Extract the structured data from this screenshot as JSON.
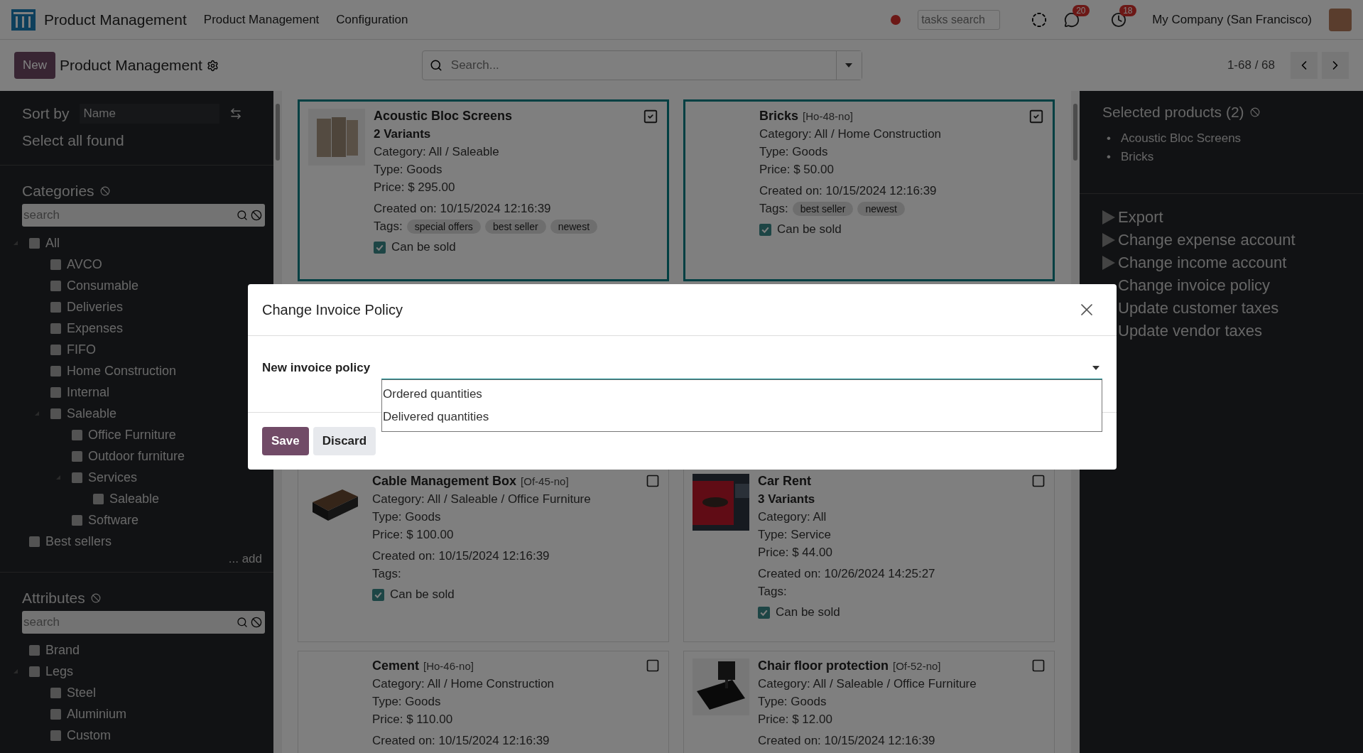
{
  "navbar": {
    "app_name": "Product Management",
    "menus": [
      "Product Management",
      "Configuration"
    ],
    "tasks_search": {
      "placeholder": "tasks search"
    },
    "messages_badge": "20",
    "activities_badge": "18",
    "company": "My Company (San Francisco)"
  },
  "control_panel": {
    "new_button": "New",
    "breadcrumb": "Product Management",
    "search": {
      "placeholder": "Search..."
    },
    "pager": "1-68 / 68"
  },
  "sidebar": {
    "sort_label": "Sort by",
    "sort_value": "Name",
    "select_all": "Select all found",
    "sections": [
      {
        "title": "Categories",
        "search_placeholder": "search",
        "add_link": "... add",
        "tree": [
          {
            "label": "All",
            "checked": false,
            "children": [
              {
                "label": "AVCO",
                "checked": false
              },
              {
                "label": "Consumable",
                "checked": false
              },
              {
                "label": "Deliveries",
                "checked": false
              },
              {
                "label": "Expenses",
                "checked": false
              },
              {
                "label": "FIFO",
                "checked": false
              },
              {
                "label": "Home Construction",
                "checked": false
              },
              {
                "label": "Internal",
                "checked": false
              },
              {
                "label": "Saleable",
                "checked": false,
                "children": [
                  {
                    "label": "Office Furniture",
                    "checked": false
                  },
                  {
                    "label": "Outdoor furniture",
                    "checked": false
                  },
                  {
                    "label": "Services",
                    "checked": false,
                    "children": [
                      {
                        "label": "Saleable",
                        "checked": false
                      }
                    ]
                  },
                  {
                    "label": "Software",
                    "checked": false
                  }
                ]
              }
            ]
          },
          {
            "label": "Best sellers",
            "checked": false
          }
        ]
      },
      {
        "title": "Attributes",
        "search_placeholder": "search",
        "tree": [
          {
            "label": "Brand",
            "checked": false
          },
          {
            "label": "Legs",
            "checked": false,
            "children": [
              {
                "label": "Steel",
                "checked": false
              },
              {
                "label": "Aluminium",
                "checked": false
              },
              {
                "label": "Custom",
                "checked": false
              }
            ]
          }
        ]
      }
    ]
  },
  "cards": [
    {
      "name": "Acoustic Bloc Screens",
      "variants": "2 Variants",
      "has_image": true,
      "selected": true,
      "details": [
        "Category: All / Saleable",
        "Type: Goods",
        "Price: $ 295.00"
      ],
      "created": "Created on: 10/15/2024 12:16:39",
      "tags_label": "Tags:",
      "tags": [
        "special offers",
        "best seller",
        "newest"
      ],
      "sale": {
        "label": "Can be sold",
        "checked": true
      }
    },
    {
      "name": "Bricks",
      "code": "[Ho-48-no]",
      "has_image": false,
      "selected": true,
      "details": [
        "Category: All / Home Construction",
        "Type: Goods",
        "Price: $ 50.00"
      ],
      "created": "Created on: 10/15/2024 12:16:39",
      "tags_label": "Tags:",
      "tags": [
        "best seller",
        "newest"
      ],
      "sale": {
        "label": "Can be sold",
        "checked": true
      }
    },
    {
      "name": "Cable Management Box",
      "code": "[Of-45-no]",
      "has_image": true,
      "selected": false,
      "details": [
        "Category: All / Saleable / Office Furniture",
        "Type: Goods",
        "Price: $ 100.00"
      ],
      "created": "Created on: 10/15/2024 12:16:39",
      "tags_label": "Tags:",
      "sale": {
        "label": "Can be sold",
        "checked": true
      }
    },
    {
      "name": "Car Rent",
      "variants": "3 Variants",
      "has_image": true,
      "selected": false,
      "details": [
        "Category: All",
        "Type: Service",
        "Price: $ 44.00"
      ],
      "created": "Created on: 10/26/2024 14:25:27",
      "tags_label": "Tags:",
      "sale": {
        "label": "Can be sold",
        "checked": true
      }
    },
    {
      "name": "Cement",
      "code": "[Ho-46-no]",
      "has_image": false,
      "selected": false,
      "details": [
        "Category: All / Home Construction",
        "Type: Goods",
        "Price: $ 110.00"
      ],
      "created": "Created on: 10/15/2024 12:16:39"
    },
    {
      "name": "Chair floor protection",
      "code": "[Of-52-no]",
      "has_image": true,
      "selected": false,
      "details": [
        "Category: All / Saleable / Office Furniture",
        "Type: Goods",
        "Price: $ 12.00"
      ],
      "created": "Created on: 10/15/2024 12:16:39"
    }
  ],
  "selection_panel": {
    "title": "Selected products (2)",
    "items": [
      {
        "bullet": "•",
        "label": "Acoustic Bloc Screens"
      },
      {
        "bullet": "•",
        "label": "Bricks"
      }
    ],
    "actions": [
      {
        "label": "Export",
        "arrow": true
      },
      {
        "label": "Change expense account",
        "arrow": true
      },
      {
        "label": "Change income account",
        "arrow": true
      },
      {
        "label": "Change invoice policy",
        "arrow": false
      },
      {
        "label": "Update customer taxes",
        "arrow": false
      },
      {
        "label": "Update vendor taxes",
        "arrow": false
      }
    ]
  },
  "dialog": {
    "title": "Change Invoice Policy",
    "field_label": "New invoice policy",
    "options": [
      "Ordered quantities",
      "Delivered quantities"
    ],
    "buttons": [
      {
        "label": "Save",
        "kind": "primary"
      },
      {
        "label": "Discard",
        "kind": "secondary"
      }
    ]
  }
}
